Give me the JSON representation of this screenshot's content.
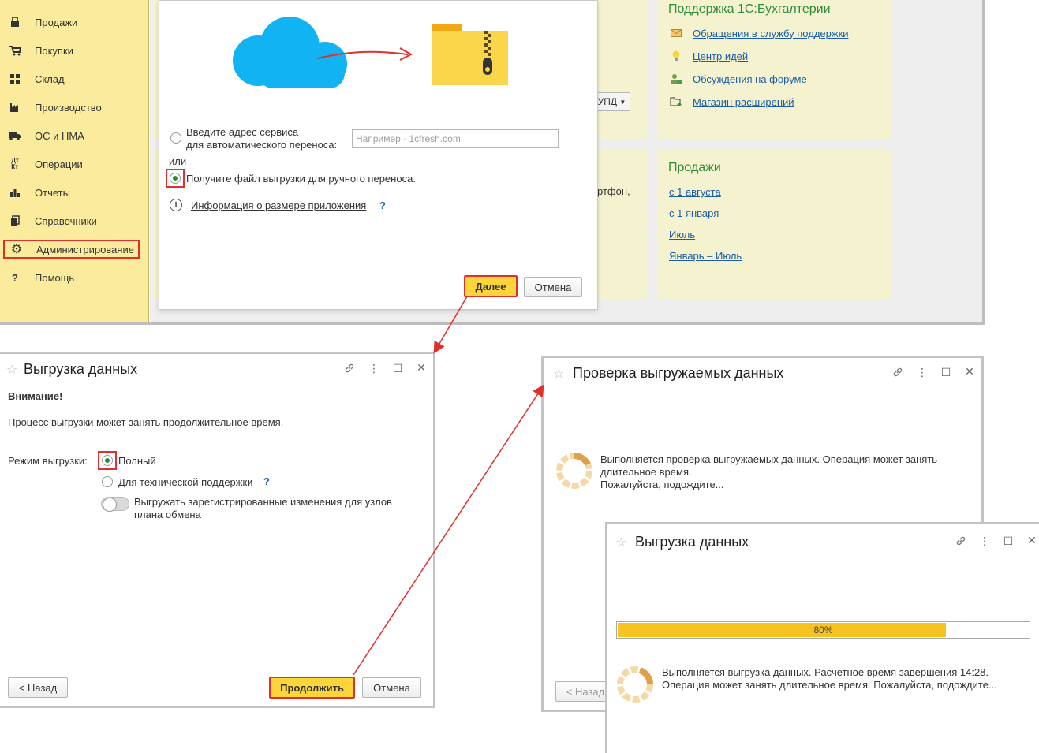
{
  "sidebar": {
    "items": [
      {
        "label": "Продажи",
        "icon": "cart-sales-icon"
      },
      {
        "label": "Покупки",
        "icon": "cart-icon"
      },
      {
        "label": "Склад",
        "icon": "warehouse-icon"
      },
      {
        "label": "Производство",
        "icon": "factory-icon"
      },
      {
        "label": "ОС и НМА",
        "icon": "truck-icon"
      },
      {
        "label": "Операции",
        "icon": "debit-credit-icon"
      },
      {
        "label": "Отчеты",
        "icon": "bar-chart-icon"
      },
      {
        "label": "Справочники",
        "icon": "books-icon"
      },
      {
        "label": "Администрирование",
        "icon": "gear-icon"
      },
      {
        "label": "Помощь",
        "icon": "question-icon"
      }
    ]
  },
  "support": {
    "title": "Поддержка 1С:Бухгалтерии",
    "links": [
      {
        "label": "Обращения в службу поддержки",
        "icon": "envelope-icon"
      },
      {
        "label": "Центр идей",
        "icon": "lightbulb-icon"
      },
      {
        "label": "Обсуждения на форуме",
        "icon": "forum-user-icon"
      },
      {
        "label": "Магазин расширений",
        "icon": "folder-plus-icon"
      }
    ]
  },
  "sales": {
    "title": "Продажи",
    "links": [
      "с 1 августа",
      "с 1 января",
      "Июль",
      "Январь – Июль"
    ]
  },
  "background": {
    "upd_button": "УПД",
    "fragment_text": "ртфон,"
  },
  "transfer_dialog": {
    "radio_auto_line1": "Введите адрес сервиса",
    "radio_auto_line2": "для автоматического переноса:",
    "address_placeholder": "Например - 1cfresh.com",
    "or_label": "или",
    "radio_manual": "Получите файл выгрузки для ручного переноса.",
    "info_link": "Информация о размере приложения",
    "help": "?",
    "next_button": "Далее",
    "cancel_button": "Отмена"
  },
  "export_dialog": {
    "title": "Выгрузка данных",
    "warning": "Внимание!",
    "description": "Процесс выгрузки может занять продолжительное время.",
    "mode_label": "Режим выгрузки:",
    "mode_full": "Полный",
    "mode_support": "Для технической поддержки",
    "help": "?",
    "toggle_line1": "Выгружать зарегистрированные изменения для узлов",
    "toggle_line2": "плана обмена",
    "back_button": "< Назад",
    "continue_button": "Продолжить",
    "cancel_button": "Отмена"
  },
  "check_dialog": {
    "title": "Проверка выгружаемых данных",
    "line1": "Выполняется проверка выгружаемых данных. Операция может занять",
    "line2": "длительное время.",
    "line3": "Пожалуйста, подождите...",
    "back_button": "< Назад"
  },
  "progress_dialog": {
    "title": "Выгрузка данных",
    "progress_percent": 80,
    "progress_label": "80%",
    "line1": "Выполняется выгрузка данных. Расчетное время завершения 14:28.",
    "line2": "Операция может занять длительное время. Пожалуйста, подождите..."
  },
  "colors": {
    "sidebar_bg": "#fbeb9c",
    "accent_yellow": "#fbd53a",
    "highlight_red": "#e0302c",
    "link_blue": "#1a5ea8",
    "title_green": "#2e8b3a",
    "cloud_blue": "#12b3f2",
    "folder_yellow": "#f7c320"
  }
}
